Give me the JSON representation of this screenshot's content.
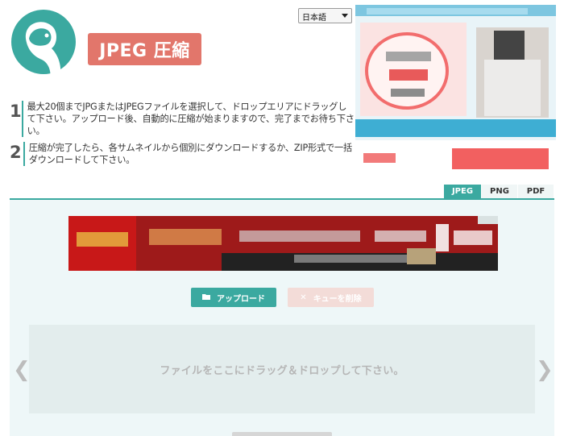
{
  "brand": {
    "title": "JPEG 圧縮",
    "accent": "#e2766b",
    "primary": "#3ba9a0"
  },
  "language": {
    "selected": "日本語"
  },
  "steps": [
    {
      "num": "1",
      "text": "最大20個までJPGまたはJPEGファイルを選択して、ドロップエリアにドラッグして下さい。アップロード後、自動的に圧縮が始まりますので、完了までお待ち下さい。"
    },
    {
      "num": "2",
      "text": "圧縮が完了したら、各サムネイルから個別にダウンロードするか、ZIP形式で一括ダウンロードして下さい。"
    }
  ],
  "tabs": [
    {
      "label": "JPEG",
      "active": true
    },
    {
      "label": "PNG",
      "active": false
    },
    {
      "label": "PDF",
      "active": false
    }
  ],
  "buttons": {
    "upload": "アップロード",
    "upload_icon": "folder-icon",
    "clear": "キューを削除",
    "clear_icon": "close-icon"
  },
  "dropzone": {
    "text": "ファイルをここにドラッグ＆ドロップして下さい。"
  },
  "nav": {
    "prev": "❮",
    "next": "❯"
  }
}
